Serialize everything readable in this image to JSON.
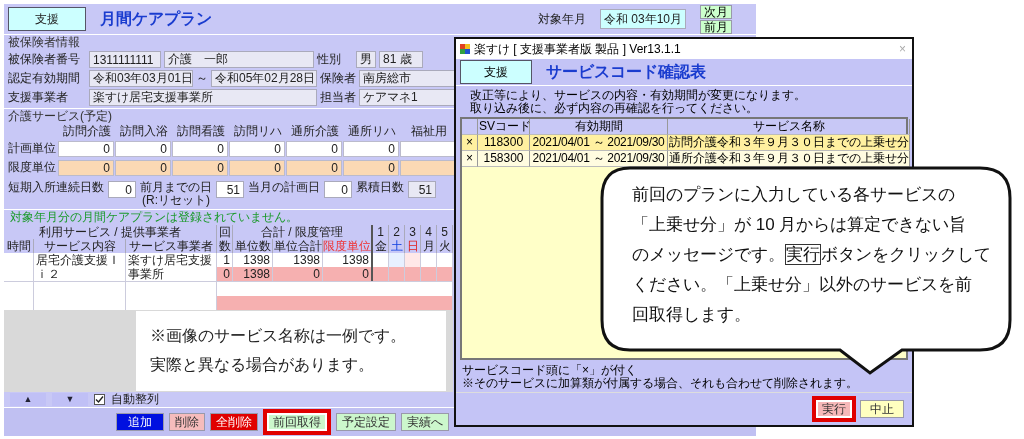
{
  "main": {
    "badge": "支援",
    "title": "月間ケアプラン",
    "target_month": {
      "label": "対象年月",
      "value": "令和 03年10月"
    },
    "month_buttons": [
      "次月",
      "前月"
    ],
    "insured": {
      "legend": "被保険者情報",
      "number_label": "被保険者番号",
      "number": "1311111111",
      "name": "介護　一郎",
      "gender_label": "性別",
      "gender": "男",
      "age": "81 歳",
      "period_label": "認定有効期間",
      "period_start": "令和03年03月01日",
      "period_sep": "～",
      "period_end": "令和05年02月28日",
      "insurer_label": "保険者",
      "insurer": "南房総市",
      "provider_label": "支援事業者",
      "provider": "楽すけ居宅支援事業所",
      "manager_label": "担当者",
      "manager": "ケアマネ1"
    },
    "services": {
      "legend": "介護サービス(予定)",
      "columns": [
        "訪問介護",
        "訪問入浴",
        "訪問看護",
        "訪問リハ",
        "通所介護",
        "通所リハ",
        "福祉用"
      ],
      "rows": [
        {
          "label": "計画単位",
          "kind": "plan",
          "values": [
            "0",
            "0",
            "0",
            "0",
            "0",
            "0"
          ]
        },
        {
          "label": "限度単位",
          "kind": "limit",
          "values": [
            "0",
            "0",
            "0",
            "0",
            "0",
            "0"
          ]
        }
      ]
    },
    "short_stay": {
      "consecutive_label": "短期入所連続日数",
      "consecutive": "0",
      "prev_label": "前月までの日",
      "prev": "51",
      "prev_note": "(R:リセット)",
      "plan_label": "当月の計画日",
      "plan": "0",
      "total_label": "累積日数",
      "total": "51"
    },
    "notice": "対象年月分の月間ケアプランは登録されていません。",
    "plan_table": {
      "group_service": "利用サービス / 提供事業者",
      "group_count": "回",
      "group_total": "合計 / 限度管理",
      "col_time": "時間",
      "col_content": "サービス内容",
      "col_provider": "サービス事業者",
      "col_count": "数",
      "col_units": "単位数",
      "col_sum": "単位合計",
      "col_limit": "限度単位",
      "days": [
        {
          "day": "1",
          "weekday": "金",
          "kind": "weekday"
        },
        {
          "day": "2",
          "weekday": "土",
          "kind": "saturday"
        },
        {
          "day": "3",
          "weekday": "日",
          "kind": "sunday"
        },
        {
          "day": "4",
          "weekday": "月",
          "kind": "weekday"
        },
        {
          "day": "5",
          "weekday": "火",
          "kind": "weekday"
        }
      ],
      "records": [
        {
          "content": "居宅介護支援Ｉｉ２",
          "provider": "楽すけ居宅支援事業所",
          "plan": {
            "count": "1",
            "units": "1398",
            "sum": "1398",
            "limit": "1398"
          },
          "actual": {
            "count": "0",
            "units": "1398",
            "sum": "0",
            "limit": "0"
          }
        }
      ]
    },
    "note_lines": [
      "※画像のサービス名称は一例です。",
      "実際と異なる場合があります。"
    ],
    "sort": {
      "up": "▲",
      "down": "▼",
      "auto_label": "自動整列",
      "auto_checked": true
    },
    "buttons": [
      {
        "label": "追加",
        "kind": "primary",
        "highlighted": false
      },
      {
        "label": "削除",
        "kind": "soft-danger",
        "highlighted": false
      },
      {
        "label": "全削除",
        "kind": "danger",
        "highlighted": false
      },
      {
        "label": "前回取得",
        "kind": "normal",
        "highlighted": true
      },
      {
        "label": "予定設定",
        "kind": "normal",
        "highlighted": false
      },
      {
        "label": "実績へ",
        "kind": "normal",
        "highlighted": false
      }
    ]
  },
  "dialog": {
    "title": "楽すけ [ 支援事業者版 製品 ] Ver13.1.1",
    "close": "×",
    "badge": "支援",
    "heading": "サービスコード確認表",
    "messages": [
      "改正等により、サービスの内容・有効期間が変更になります。",
      "取り込み後に、必ず内容の再確認を行ってください。"
    ],
    "columns": [
      "SVコード",
      "有効期間",
      "サービス名称"
    ],
    "rows": [
      {
        "mark": "×",
        "code": "118300",
        "period": "2021/04/01 ～ 2021/09/30",
        "name": "訪問介護令和３年９月３０日までの上乗せ分",
        "selected": true
      },
      {
        "mark": "×",
        "code": "158300",
        "period": "2021/04/01 ～ 2021/09/30",
        "name": "通所介護令和３年９月３０日までの上乗せ分",
        "selected": false
      }
    ],
    "footer_notes": [
      "サービスコード頭に「×」が付く",
      "※そのサービスに加算類が付属する場合、それも合わせて削除されます。"
    ],
    "buttons": [
      {
        "label": "実行",
        "kind": "execute",
        "highlighted": true
      },
      {
        "label": "中止",
        "kind": "cancel",
        "highlighted": false
      }
    ]
  },
  "callout": {
    "lines": [
      {
        "text": "前回のプランに入力している各サービスの"
      },
      {
        "text": "「上乗せ分」が 10 月からは算定できない旨"
      },
      {
        "text": "のメッセージです。",
        "boxed": "実行",
        "after": "ボタンをクリックして"
      },
      {
        "text": "ください。「上乗せ分」以外のサービスを前"
      },
      {
        "text": "回取得します。"
      }
    ]
  }
}
